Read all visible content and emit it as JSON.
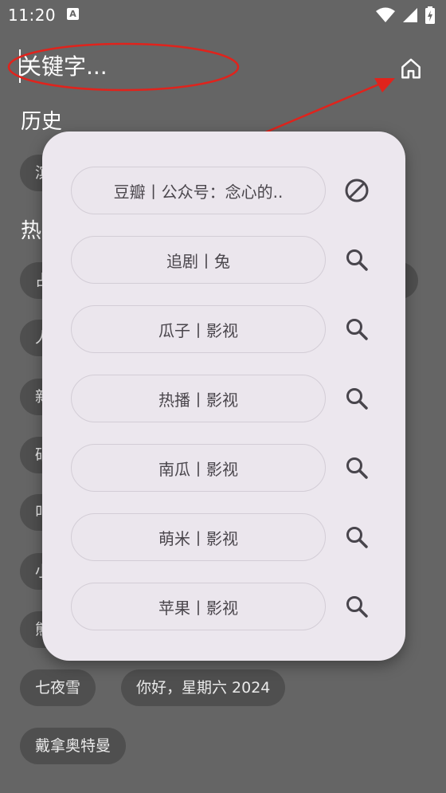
{
  "status_bar": {
    "time": "11:20",
    "notification_icon": "a-letter-icon",
    "system_icons": [
      "wifi-icon",
      "cell-signal-icon",
      "battery-charging-icon"
    ]
  },
  "search": {
    "placeholder": "关键字...",
    "value": ""
  },
  "header": {
    "home_icon": "home-icon"
  },
  "history": {
    "title": "历史",
    "chips": [
      "滨"
    ]
  },
  "hot": {
    "title": "热",
    "chips": [
      "占",
      "人",
      "新",
      "砧",
      "叫",
      "小",
      "熊",
      "七夜雪",
      "你好，星期六 2024",
      "戴拿奥特曼"
    ]
  },
  "popup": {
    "sources": [
      {
        "label": "豆瓣丨公众号：念心的..",
        "icon": "block-icon"
      },
      {
        "label": "追剧丨兔",
        "icon": "search-icon"
      },
      {
        "label": "瓜子丨影视",
        "icon": "search-icon"
      },
      {
        "label": "热播丨影视",
        "icon": "search-icon"
      },
      {
        "label": "南瓜丨影视",
        "icon": "search-icon"
      },
      {
        "label": "萌米丨影视",
        "icon": "search-icon"
      },
      {
        "label": "苹果丨影视",
        "icon": "search-icon"
      }
    ]
  },
  "colors": {
    "background": "#656565",
    "chip": "#4f4f4f",
    "popup": "#ece7ee",
    "annotation": "#e0231c"
  }
}
